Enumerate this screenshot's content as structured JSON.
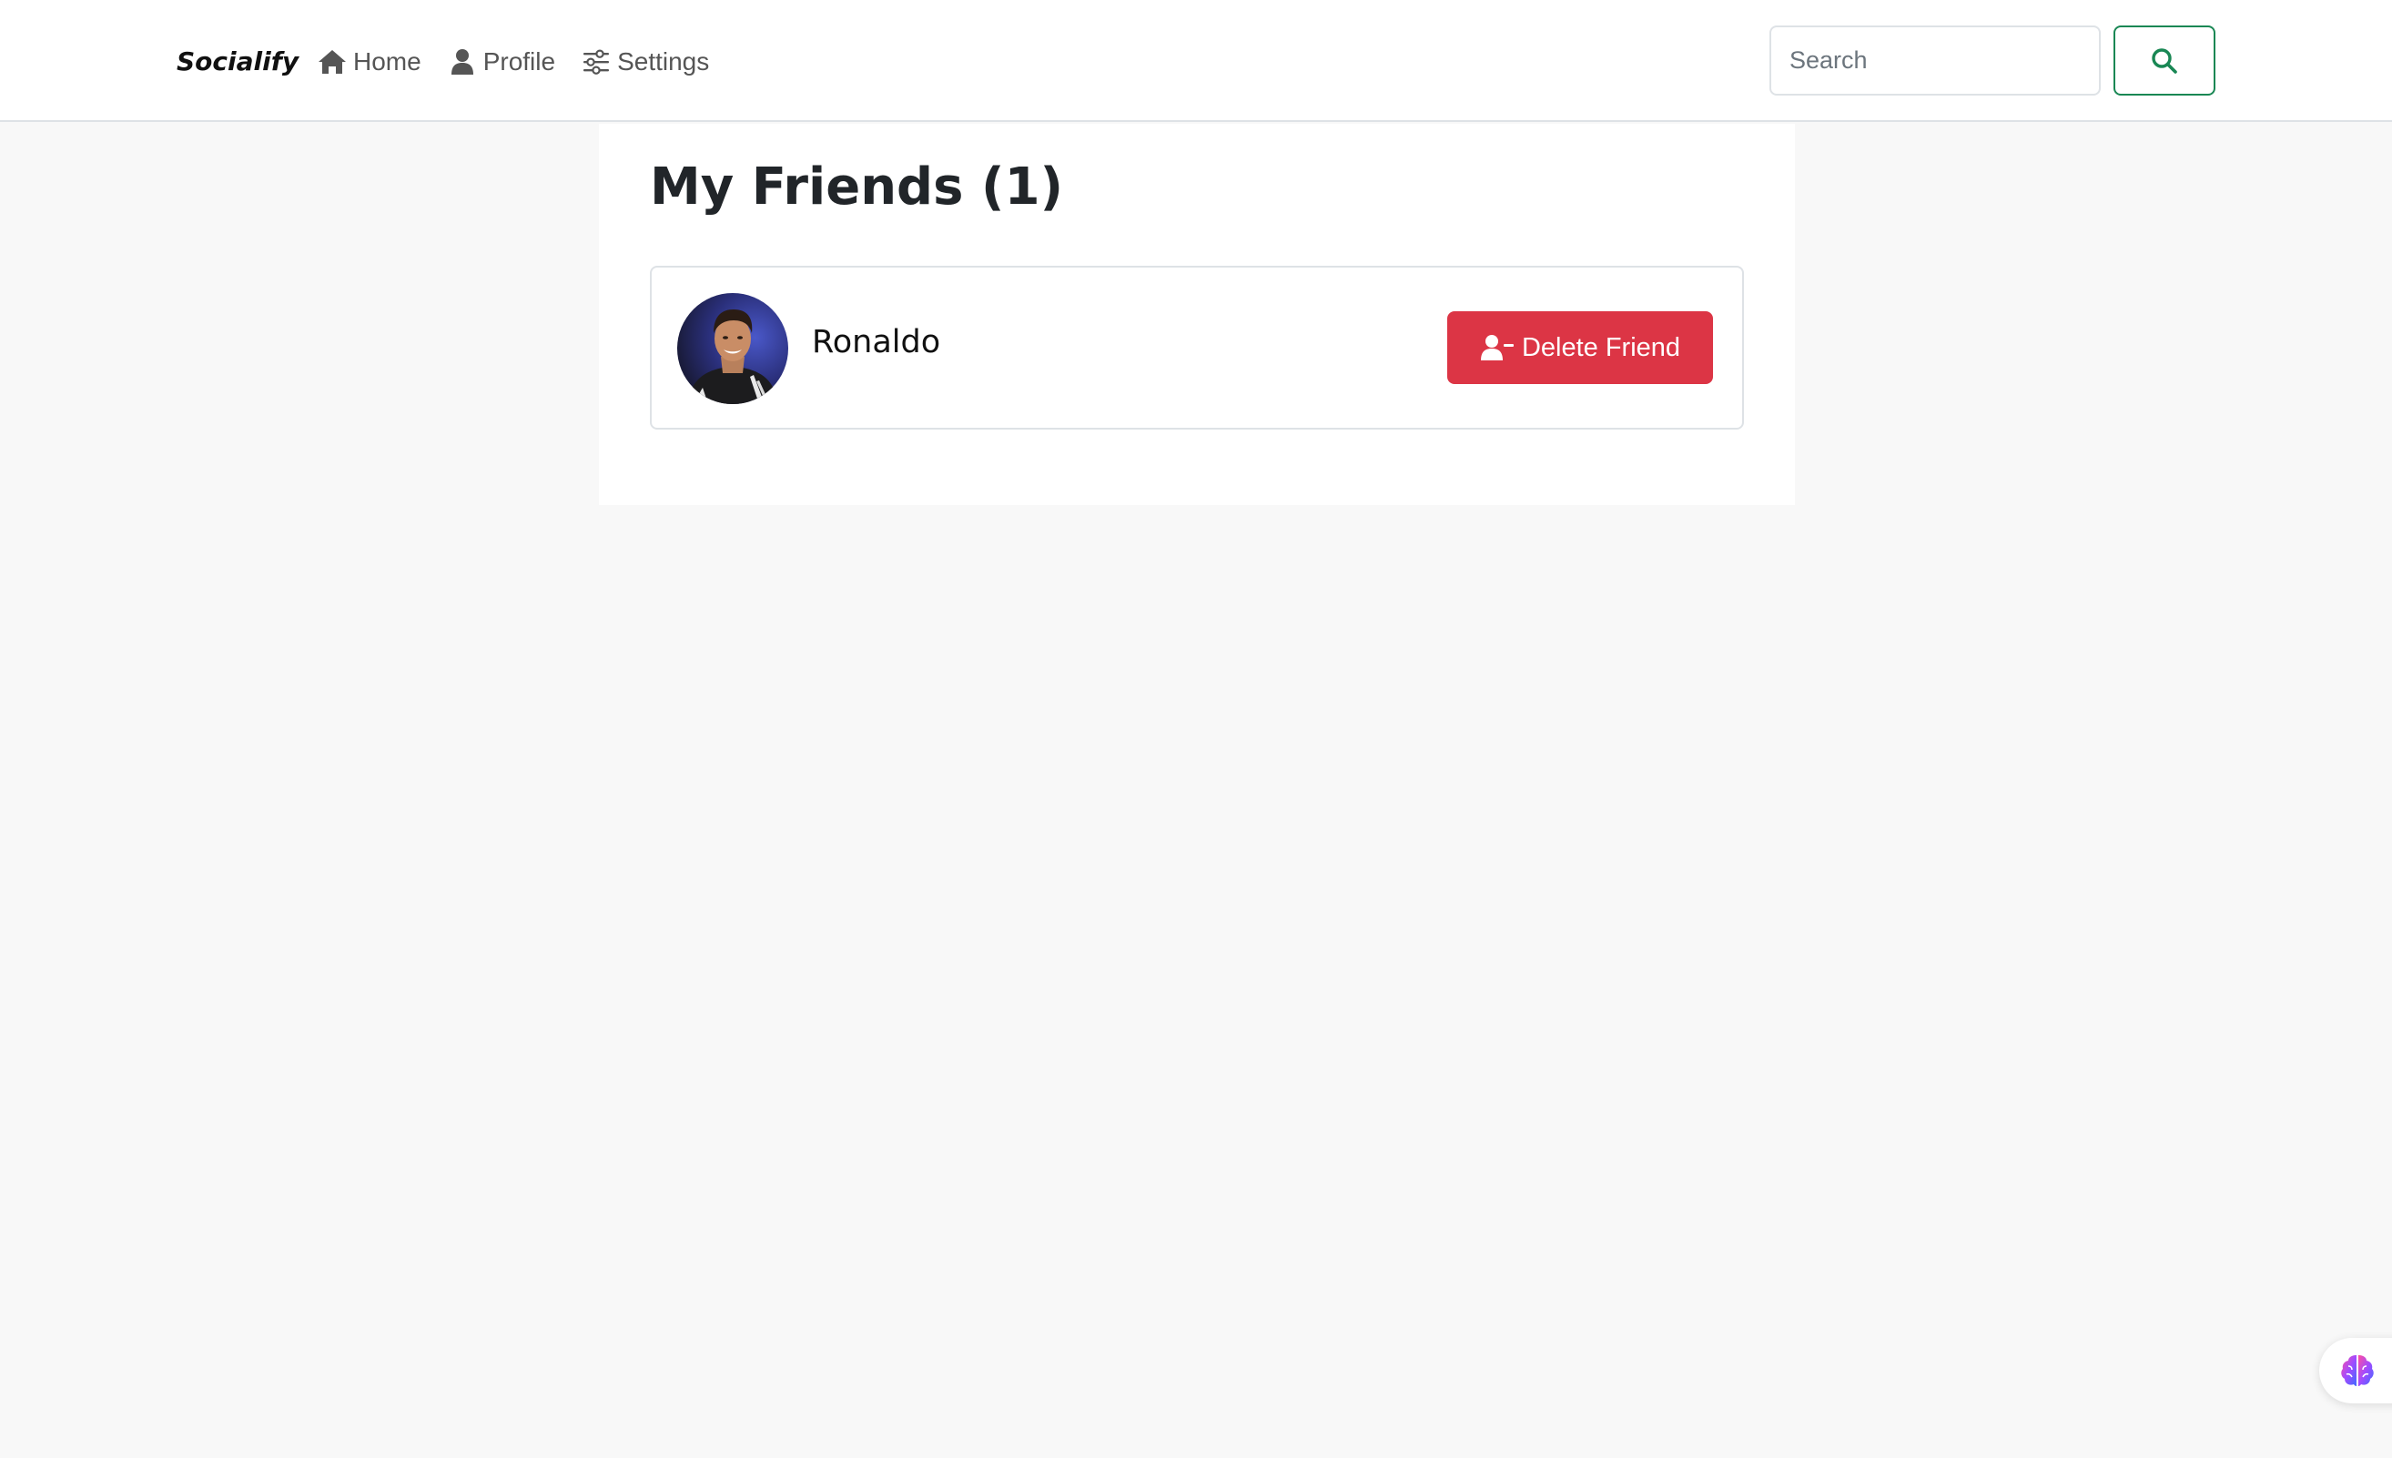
{
  "navbar": {
    "brand": "Socialify",
    "links": [
      {
        "label": "Home",
        "icon": "home-icon"
      },
      {
        "label": "Profile",
        "icon": "user-icon"
      },
      {
        "label": "Settings",
        "icon": "sliders-icon"
      }
    ],
    "search": {
      "placeholder": "Search",
      "value": ""
    },
    "search_button_icon": "search-icon"
  },
  "main": {
    "title": "My Friends (1)",
    "friends": [
      {
        "name": "Ronaldo",
        "avatar": "friend-avatar-photo",
        "action_label": "Delete Friend",
        "action_icon": "user-minus-icon"
      }
    ]
  },
  "widget": {
    "icon": "brain-icon"
  },
  "colors": {
    "background": "#f8f8f8",
    "danger": "#dc3545",
    "success": "#198754",
    "nav_text": "#555555"
  }
}
